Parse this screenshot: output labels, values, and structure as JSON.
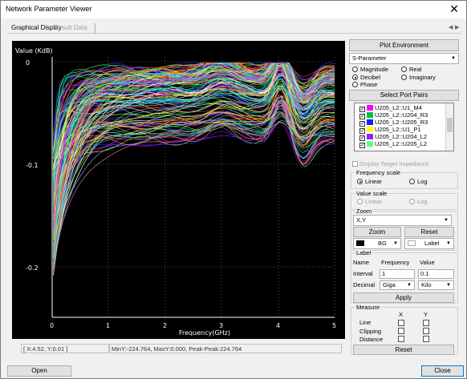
{
  "window": {
    "title": "Network Parameter Viewer",
    "close_glyph": "✕"
  },
  "tabs": [
    {
      "label": "Graphical Display"
    },
    {
      "label": "Result Data"
    }
  ],
  "plot": {
    "y_axis_label": "Value (KdB)",
    "x_axis_label": "Frequency(GHz)",
    "y_ticks": [
      "0",
      "-0.1",
      "-0.2"
    ],
    "x_ticks": [
      "0",
      "1",
      "2",
      "3",
      "4",
      "5"
    ]
  },
  "status": {
    "cursor": "[ X:4.52, Y:0.01 ]",
    "stats": "MinY:-224.764, MaxY:0.000, Peak-Peak:224.764"
  },
  "panel": {
    "plot_environment": "Plot Environment",
    "parameter_select": "S-Parameter",
    "format_options": [
      {
        "label": "Magnitude",
        "selected": false
      },
      {
        "label": "Real",
        "selected": false
      },
      {
        "label": "Decibel",
        "selected": true
      },
      {
        "label": "Imaginary",
        "selected": false
      },
      {
        "label": "Phase",
        "selected": false
      }
    ],
    "select_port_pairs": "Select Port Pairs",
    "port_pairs": [
      {
        "label": "U205_L2::U1_M4",
        "color": "#ff00ff"
      },
      {
        "label": "U205_L2::U204_R3",
        "color": "#00c040"
      },
      {
        "label": "U205_L2::U205_R3",
        "color": "#1020ff"
      },
      {
        "label": "U205_L2::U1_P1",
        "color": "#ffff00"
      },
      {
        "label": "U205_L2::U204_L2",
        "color": "#9020ff"
      },
      {
        "label": "U205_L2::U205_L2",
        "color": "#60ff80"
      }
    ],
    "display_target_impedance": "Display Target Impedance",
    "frequency_scale": {
      "title": "Frequency scale",
      "linear": "Linear",
      "log": "Log",
      "selected": "Linear"
    },
    "value_scale": {
      "title": "Value scale",
      "linear": "Linear",
      "log": "Log"
    },
    "zoom": {
      "title": "Zoom",
      "axis_select": "X,Y",
      "zoom_button": "Zoom",
      "reset_button": "Reset",
      "bg_label": "BG",
      "bg_color": "#000000",
      "label_label": "Label",
      "label_color": "#ffffff"
    },
    "label": {
      "title": "Label",
      "col_name": "Name",
      "col_frequency": "Frequency",
      "col_value": "Value",
      "interval_label": "Interval",
      "interval_frequency": "1",
      "interval_value": "0.1",
      "decimal_label": "Decimal",
      "decimal_frequency": "Giga",
      "decimal_value": "Kilo",
      "apply_button": "Apply"
    },
    "measure": {
      "title": "Measure",
      "col_x": "X",
      "col_y": "Y",
      "rows": [
        "Line",
        "Clipping",
        "Distance"
      ],
      "reset_button": "Reset"
    }
  },
  "footer": {
    "open_button": "Open",
    "close_button": "Close"
  }
}
